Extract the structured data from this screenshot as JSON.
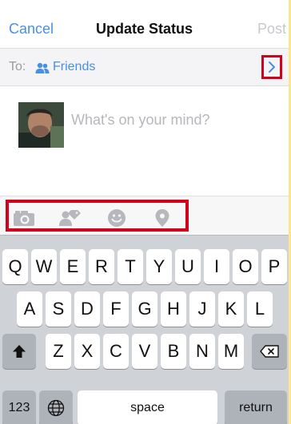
{
  "header": {
    "cancel_label": "Cancel",
    "title": "Update Status",
    "post_label": "Post"
  },
  "audience": {
    "to_label": "To:",
    "value": "Friends",
    "icon": "people-icon",
    "next_icon": "chevron-right-icon"
  },
  "composer": {
    "placeholder": "What's on your mind?"
  },
  "attachments": {
    "icons": [
      "camera-icon",
      "tag-people-icon",
      "smiley-icon",
      "location-pin-icon"
    ]
  },
  "keyboard": {
    "row1": [
      "Q",
      "W",
      "E",
      "R",
      "T",
      "Y",
      "U",
      "I",
      "O",
      "P"
    ],
    "row2": [
      "A",
      "S",
      "D",
      "F",
      "G",
      "H",
      "J",
      "K",
      "L"
    ],
    "row3": [
      "Z",
      "X",
      "C",
      "V",
      "B",
      "N",
      "M"
    ],
    "numbers_label": "123",
    "space_label": "space",
    "return_label": "return",
    "shift_icon": "shift-arrow-icon",
    "delete_icon": "backspace-icon",
    "globe_icon": "globe-icon"
  },
  "colors": {
    "accent": "#4a90e2",
    "highlight": "#d0011b",
    "page_border": "#fde68a"
  }
}
